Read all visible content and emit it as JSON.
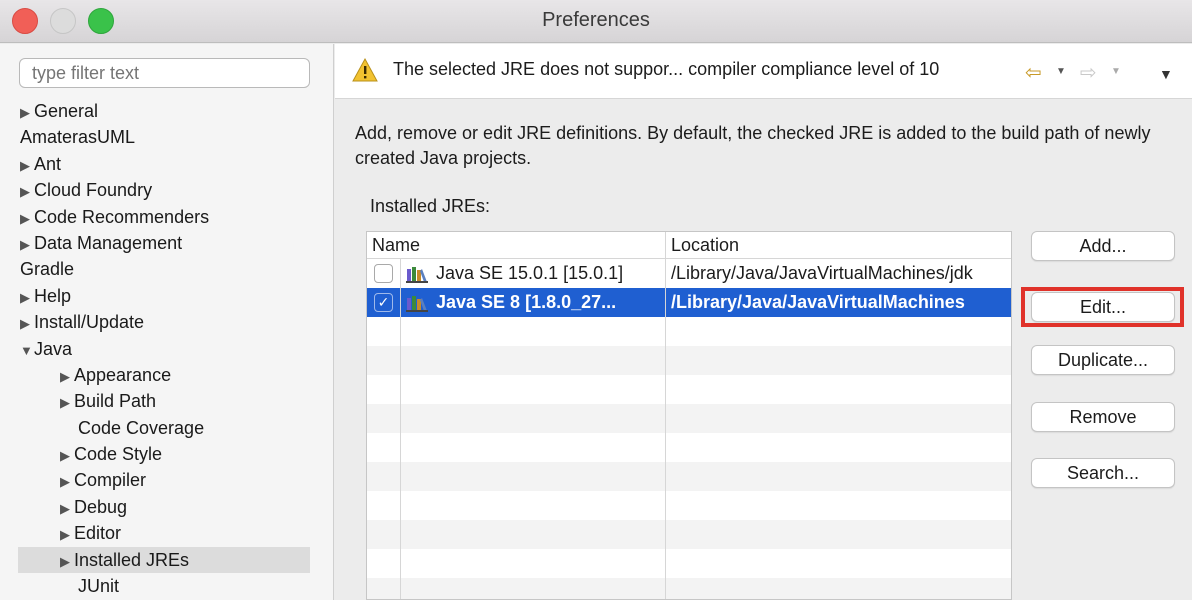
{
  "window": {
    "title": "Preferences"
  },
  "sidebar": {
    "filter_placeholder": "type filter text",
    "items": [
      {
        "label": "General",
        "level": 0,
        "arrow": "right"
      },
      {
        "label": "AmaterasUML",
        "level": 0,
        "arrow": "none"
      },
      {
        "label": "Ant",
        "level": 0,
        "arrow": "right"
      },
      {
        "label": "Cloud Foundry",
        "level": 0,
        "arrow": "right"
      },
      {
        "label": "Code Recommenders",
        "level": 0,
        "arrow": "right"
      },
      {
        "label": "Data Management",
        "level": 0,
        "arrow": "right"
      },
      {
        "label": "Gradle",
        "level": 0,
        "arrow": "none"
      },
      {
        "label": "Help",
        "level": 0,
        "arrow": "right"
      },
      {
        "label": "Install/Update",
        "level": 0,
        "arrow": "right"
      },
      {
        "label": "Java",
        "level": 0,
        "arrow": "down"
      },
      {
        "label": "Appearance",
        "level": 1,
        "arrow": "right"
      },
      {
        "label": "Build Path",
        "level": 1,
        "arrow": "right"
      },
      {
        "label": "Code Coverage",
        "level": 1,
        "arrow": "none"
      },
      {
        "label": "Code Style",
        "level": 1,
        "arrow": "right"
      },
      {
        "label": "Compiler",
        "level": 1,
        "arrow": "right"
      },
      {
        "label": "Debug",
        "level": 1,
        "arrow": "right"
      },
      {
        "label": "Editor",
        "level": 1,
        "arrow": "right"
      },
      {
        "label": "Installed JREs",
        "level": 1,
        "arrow": "right",
        "selected": true
      },
      {
        "label": "JUnit",
        "level": 1,
        "arrow": "none"
      }
    ]
  },
  "header": {
    "warning_text": "The selected JRE does not suppor... compiler compliance level of 10"
  },
  "main": {
    "description": "Add, remove or edit JRE definitions. By default, the checked JRE is added to the build path of newly created Java projects.",
    "installed_label": "Installed JREs:",
    "table": {
      "columns": [
        "Name",
        "Location"
      ],
      "rows": [
        {
          "checked": false,
          "name": "Java SE 15.0.1 [15.0.1]",
          "location": "/Library/Java/JavaVirtualMachines/jdk",
          "selected": false
        },
        {
          "checked": true,
          "name": "Java SE 8 [1.8.0_27...",
          "location": "/Library/Java/JavaVirtualMachines",
          "selected": true
        }
      ]
    },
    "buttons": {
      "add": "Add...",
      "edit": "Edit...",
      "duplicate": "Duplicate...",
      "remove": "Remove",
      "search": "Search..."
    }
  },
  "colors": {
    "selection": "#1f5fd1",
    "highlight": "#e0322a",
    "warning": "#f2c230"
  }
}
